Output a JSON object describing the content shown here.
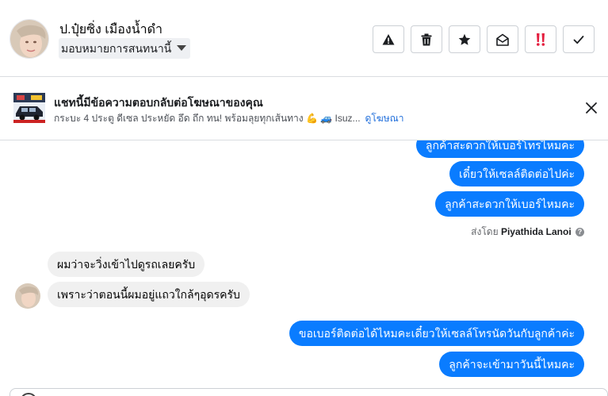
{
  "contact": {
    "name": "ป.ปุ๋ยซิ่ง เมืองน้ำดำ",
    "assign_label": "มอบหมายการสนทนานี้"
  },
  "actions": [
    {
      "name": "spam-button",
      "icon": "warning-icon"
    },
    {
      "name": "delete-button",
      "icon": "trash-icon"
    },
    {
      "name": "star-button",
      "icon": "star-icon"
    },
    {
      "name": "mark-unread-button",
      "icon": "envelope-open-icon"
    },
    {
      "name": "follow-up-button",
      "icon": "double-exclamation-icon"
    },
    {
      "name": "mark-done-button",
      "icon": "checkmark-icon"
    }
  ],
  "ad_banner": {
    "title": "แชทนี้มีข้อความตอบกลับต่อโฆษณาของคุณ",
    "subtitle": "กระบะ 4 ประตู ดีเซล ประหยัด อึด ถึก ทน! พร้อมลุยทุกเส้นทาง 💪 🚙 Isuz...",
    "link": "ดูโฆษณา"
  },
  "messages": {
    "out_partial": "ลูกค้าสะดวกให้เบอร์โทรไหมคะ",
    "out_1": "เดี๋ยวให้เซลล์ติดต่อไปค่ะ",
    "out_2": "ลูกค้าสะดวกให้เบอร์ไหมคะ",
    "sent_by_prefix": "ส่งโดย",
    "sent_by_name": "Piyathida Lanoi",
    "in_1": "ผมว่าจะวิ่งเข้าไปดูรถเลยครับ",
    "in_2": "เพราะว่าตอนนี้ผมอยู่แถวใกล้ๆอุดรครับ",
    "out_3": "ขอเบอร์ติดต่อได้ไหมคะเดี๋ยวให้เซลล์โทรนัดวันกับลูกค้าค่ะ",
    "out_4": "ลูกค้าจะเข้ามาวันนี้ไหมคะ"
  },
  "colors": {
    "outgoing_bubble": "#0a7cff",
    "incoming_bubble": "#f0f0f0",
    "link": "#216fdb",
    "follow_up_icon": "#e41e3f"
  }
}
